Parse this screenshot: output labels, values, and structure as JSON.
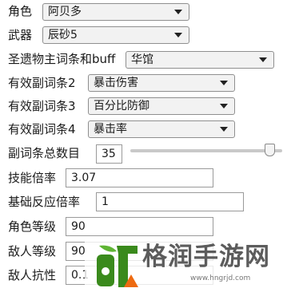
{
  "character": {
    "label": "角色",
    "value": "阿贝多"
  },
  "weapon": {
    "label": "武器",
    "value": "辰砂5"
  },
  "artifact_main": {
    "label": "圣遗物主词条和buff",
    "value": "华馆"
  },
  "sub_stat_2": {
    "label": "有效副词条2",
    "value": "暴击伤害"
  },
  "sub_stat_3": {
    "label": "有效副词条3",
    "value": "百分比防御"
  },
  "sub_stat_4": {
    "label": "有效副词条4",
    "value": "暴击率"
  },
  "sub_total": {
    "label": "副词条总数目",
    "value": "35",
    "slider_fraction": 0.95
  },
  "skill_multiplier": {
    "label": "技能倍率",
    "value": "3.07"
  },
  "reaction_multiplier": {
    "label": "基础反应倍率",
    "value": "1"
  },
  "character_level": {
    "label": "角色等级",
    "value": "90"
  },
  "enemy_level": {
    "label": "敌人等级",
    "value": "90"
  },
  "enemy_resistance": {
    "label": "敌人抗性",
    "value": "0.1"
  },
  "watermark": {
    "title": "格润手游网",
    "url": "www.hngrjd.com",
    "logo_color": "#3a8a1c",
    "logo_accent": "#ee6a10"
  }
}
